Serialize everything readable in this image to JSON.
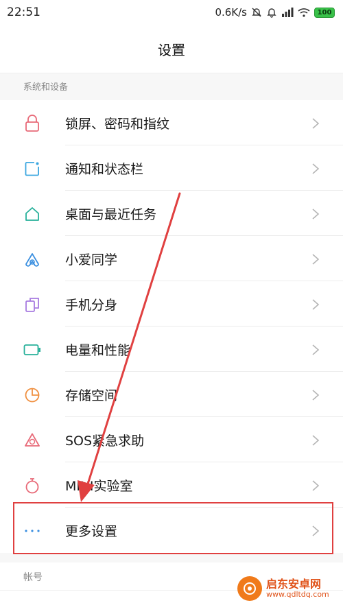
{
  "status_bar": {
    "time": "22:51",
    "net_speed": "0.6K/s",
    "battery": "100",
    "icons": [
      "mute-icon",
      "alarm-icon",
      "signal-icon",
      "wifi-icon",
      "battery-icon"
    ]
  },
  "header": {
    "title": "设置"
  },
  "section_system": {
    "title": "系统和设备"
  },
  "items": [
    {
      "label": "锁屏、密码和指纹",
      "icon": "lock-icon",
      "color": "#e86a78"
    },
    {
      "label": "通知和状态栏",
      "icon": "notification-icon",
      "color": "#3aa6e0"
    },
    {
      "label": "桌面与最近任务",
      "icon": "home-icon",
      "color": "#27b09a"
    },
    {
      "label": "小爱同学",
      "icon": "xiaoai-icon",
      "color": "#3a8fe0"
    },
    {
      "label": "手机分身",
      "icon": "dual-space-icon",
      "color": "#a77be0"
    },
    {
      "label": "电量和性能",
      "icon": "battery-outline-icon",
      "color": "#27b09a"
    },
    {
      "label": "存储空间",
      "icon": "storage-pie-icon",
      "color": "#f09040"
    },
    {
      "label": "SOS紧急求助",
      "icon": "sos-icon",
      "color": "#e86a78"
    },
    {
      "label": "MIUI实验室",
      "icon": "lab-icon",
      "color": "#e86a78"
    },
    {
      "label": "更多设置",
      "icon": "more-dots-icon",
      "color": "#3a8fe0"
    }
  ],
  "section_account": {
    "title": "帐号"
  },
  "annotation": {
    "highlight_color": "#e04040"
  },
  "watermark": {
    "name": "启东安卓网",
    "url": "www.qdltdq.com"
  }
}
